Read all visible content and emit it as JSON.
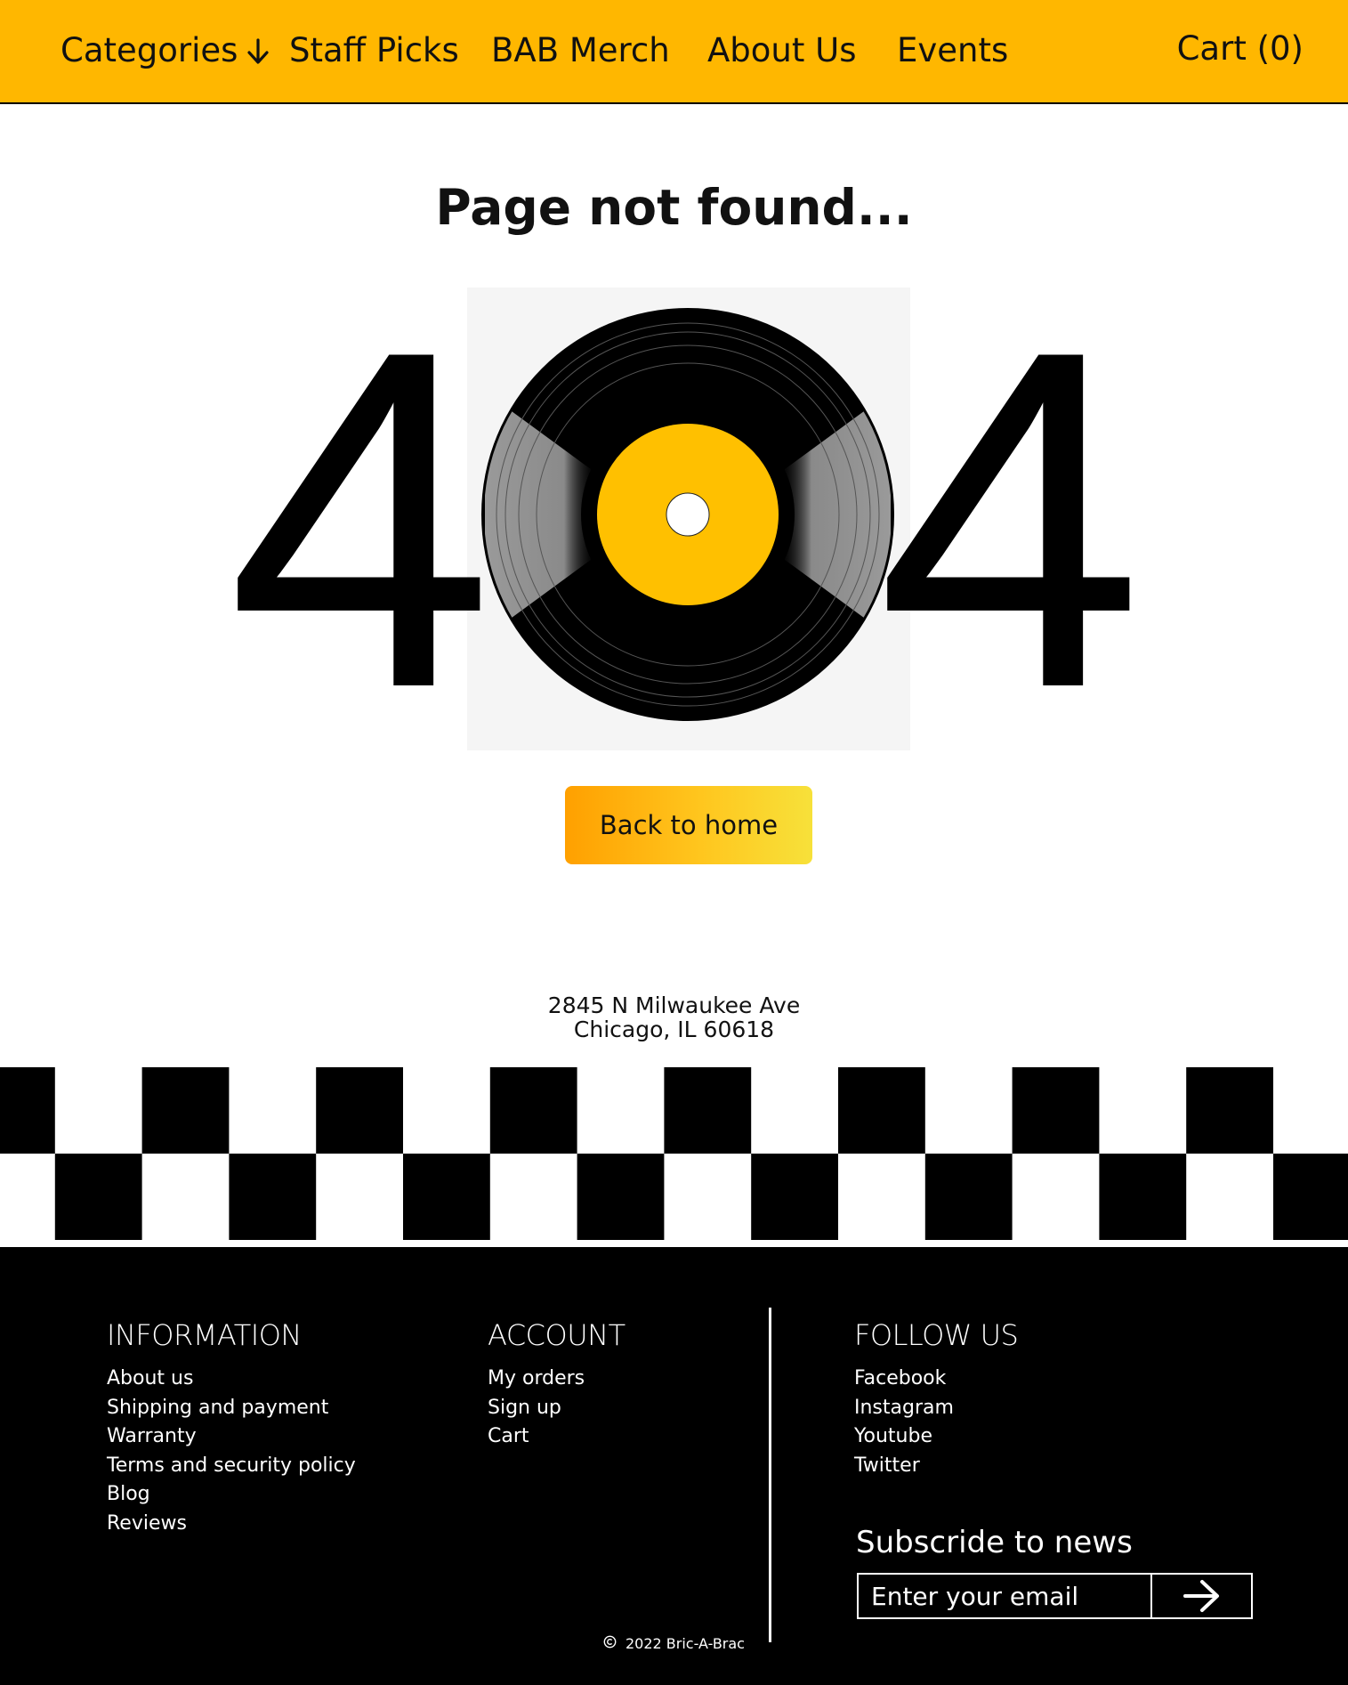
{
  "nav": {
    "categories": "Categories",
    "staff_picks": "Staff Picks",
    "merch": "BAB Merch",
    "about": "About Us",
    "events": "Events",
    "cart": "Cart (0)"
  },
  "main": {
    "title": "Page not found...",
    "digit_left": "4",
    "digit_right": "4",
    "back_button": "Back to home",
    "address_line1": "2845 N Milwaukee Ave",
    "address_line2": "Chicago, IL 60618"
  },
  "footer": {
    "information": {
      "title": "INFORMATION",
      "items": [
        "About us",
        "Shipping and payment",
        "Warranty",
        "Terms and security policy",
        "Blog",
        "Reviews"
      ]
    },
    "account": {
      "title": "ACCOUNT",
      "items": [
        "My orders",
        "Sign up",
        "Cart"
      ]
    },
    "follow": {
      "title": "FOLLOW US",
      "items": [
        "Facebook",
        "Instagram",
        "Youtube",
        "Twitter"
      ]
    },
    "subscribe": {
      "title": "Subscride to news",
      "placeholder": "Enter your email"
    },
    "copyright": "2022 Bric-A-Brac"
  },
  "icons": {
    "categories_arrow": "arrow-down-icon",
    "submit": "arrow-right-icon",
    "copyright": "copyright-icon",
    "record": "vinyl-record-icon"
  },
  "colors": {
    "header_bg": "#FFB700",
    "label_yellow": "#FFC000",
    "footer_bg": "#000000",
    "button_gradient_start": "#FFA000",
    "button_gradient_end": "#F7E13A"
  }
}
